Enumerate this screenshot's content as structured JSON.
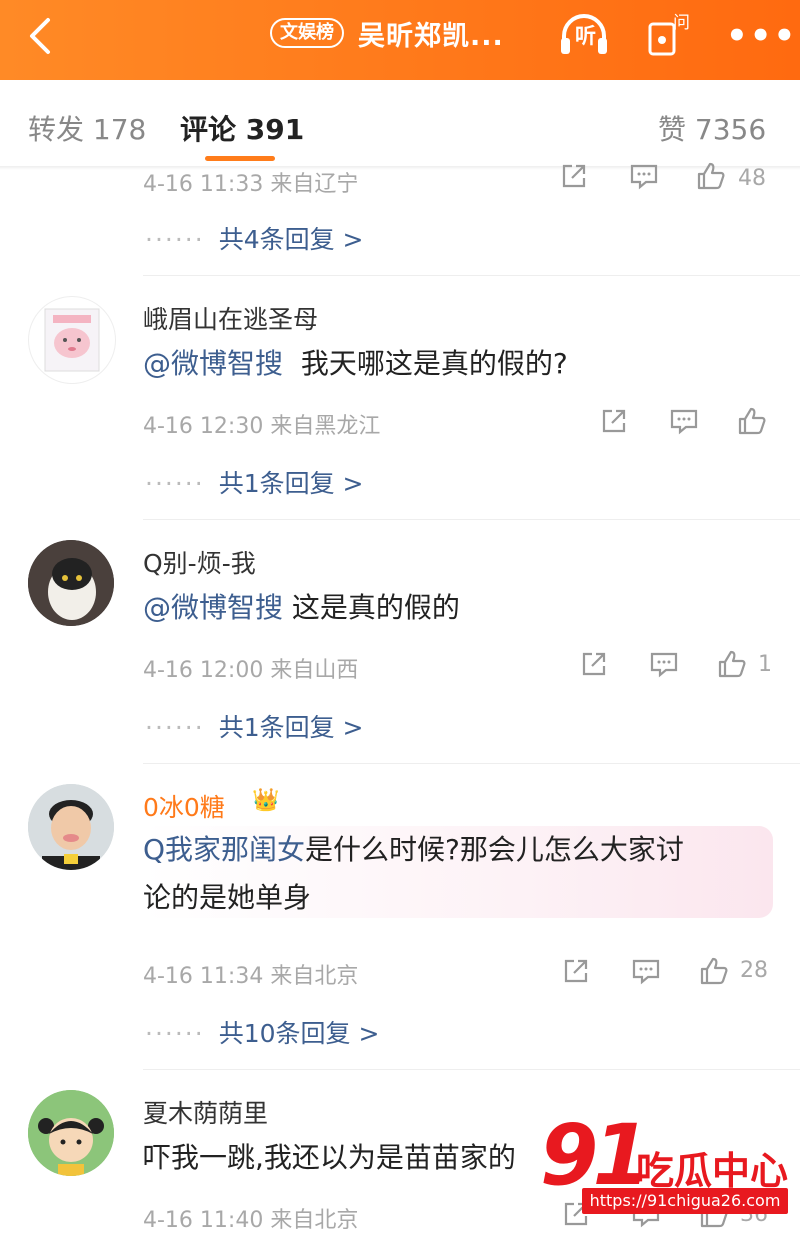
{
  "header": {
    "topic_tag": "文娱榜",
    "title": "吴昕郑凯...",
    "listen_label": "听",
    "ask_label": "问"
  },
  "tabs": {
    "repost": "转发 178",
    "comment": "评论 391",
    "like": "赞 7356"
  },
  "comments": [
    {
      "meta": "4-16 11:33 来自辽宁",
      "like_count": "48",
      "replies": "共4条回复 >"
    },
    {
      "username": "峨眉山在逃圣母",
      "mention": "@微博智搜",
      "text": "我天哪这是真的假的?",
      "meta": "4-16 12:30 来自黑龙江",
      "like_count": "",
      "replies": "共1条回复 >"
    },
    {
      "username": "Q别-烦-我",
      "mention": "@微博智搜",
      "text": "这是真的假的",
      "meta": "4-16 12:00 来自山西",
      "like_count": "1",
      "replies": "共1条回复 >"
    },
    {
      "username": "0冰0糖",
      "mention": "Q我家那闺女",
      "text_line1": "是什么时候?那会儿怎么大家讨",
      "text_line2": "论的是她单身",
      "meta": "4-16 11:34 来自北京",
      "like_count": "28",
      "replies": "共10条回复 >"
    },
    {
      "username": "夏木荫荫里",
      "text": "吓我一跳,我还以为是苗苗家的",
      "meta": "4-16 11:40 来自北京",
      "like_count": "36"
    }
  ],
  "watermark": {
    "number": "91",
    "brand": "吃瓜中心",
    "url": "https://91chigua26.com"
  },
  "colors": {
    "header": "#ff7a1a",
    "link": "#3d5e8f",
    "vip_name": "#ff7a1a"
  }
}
